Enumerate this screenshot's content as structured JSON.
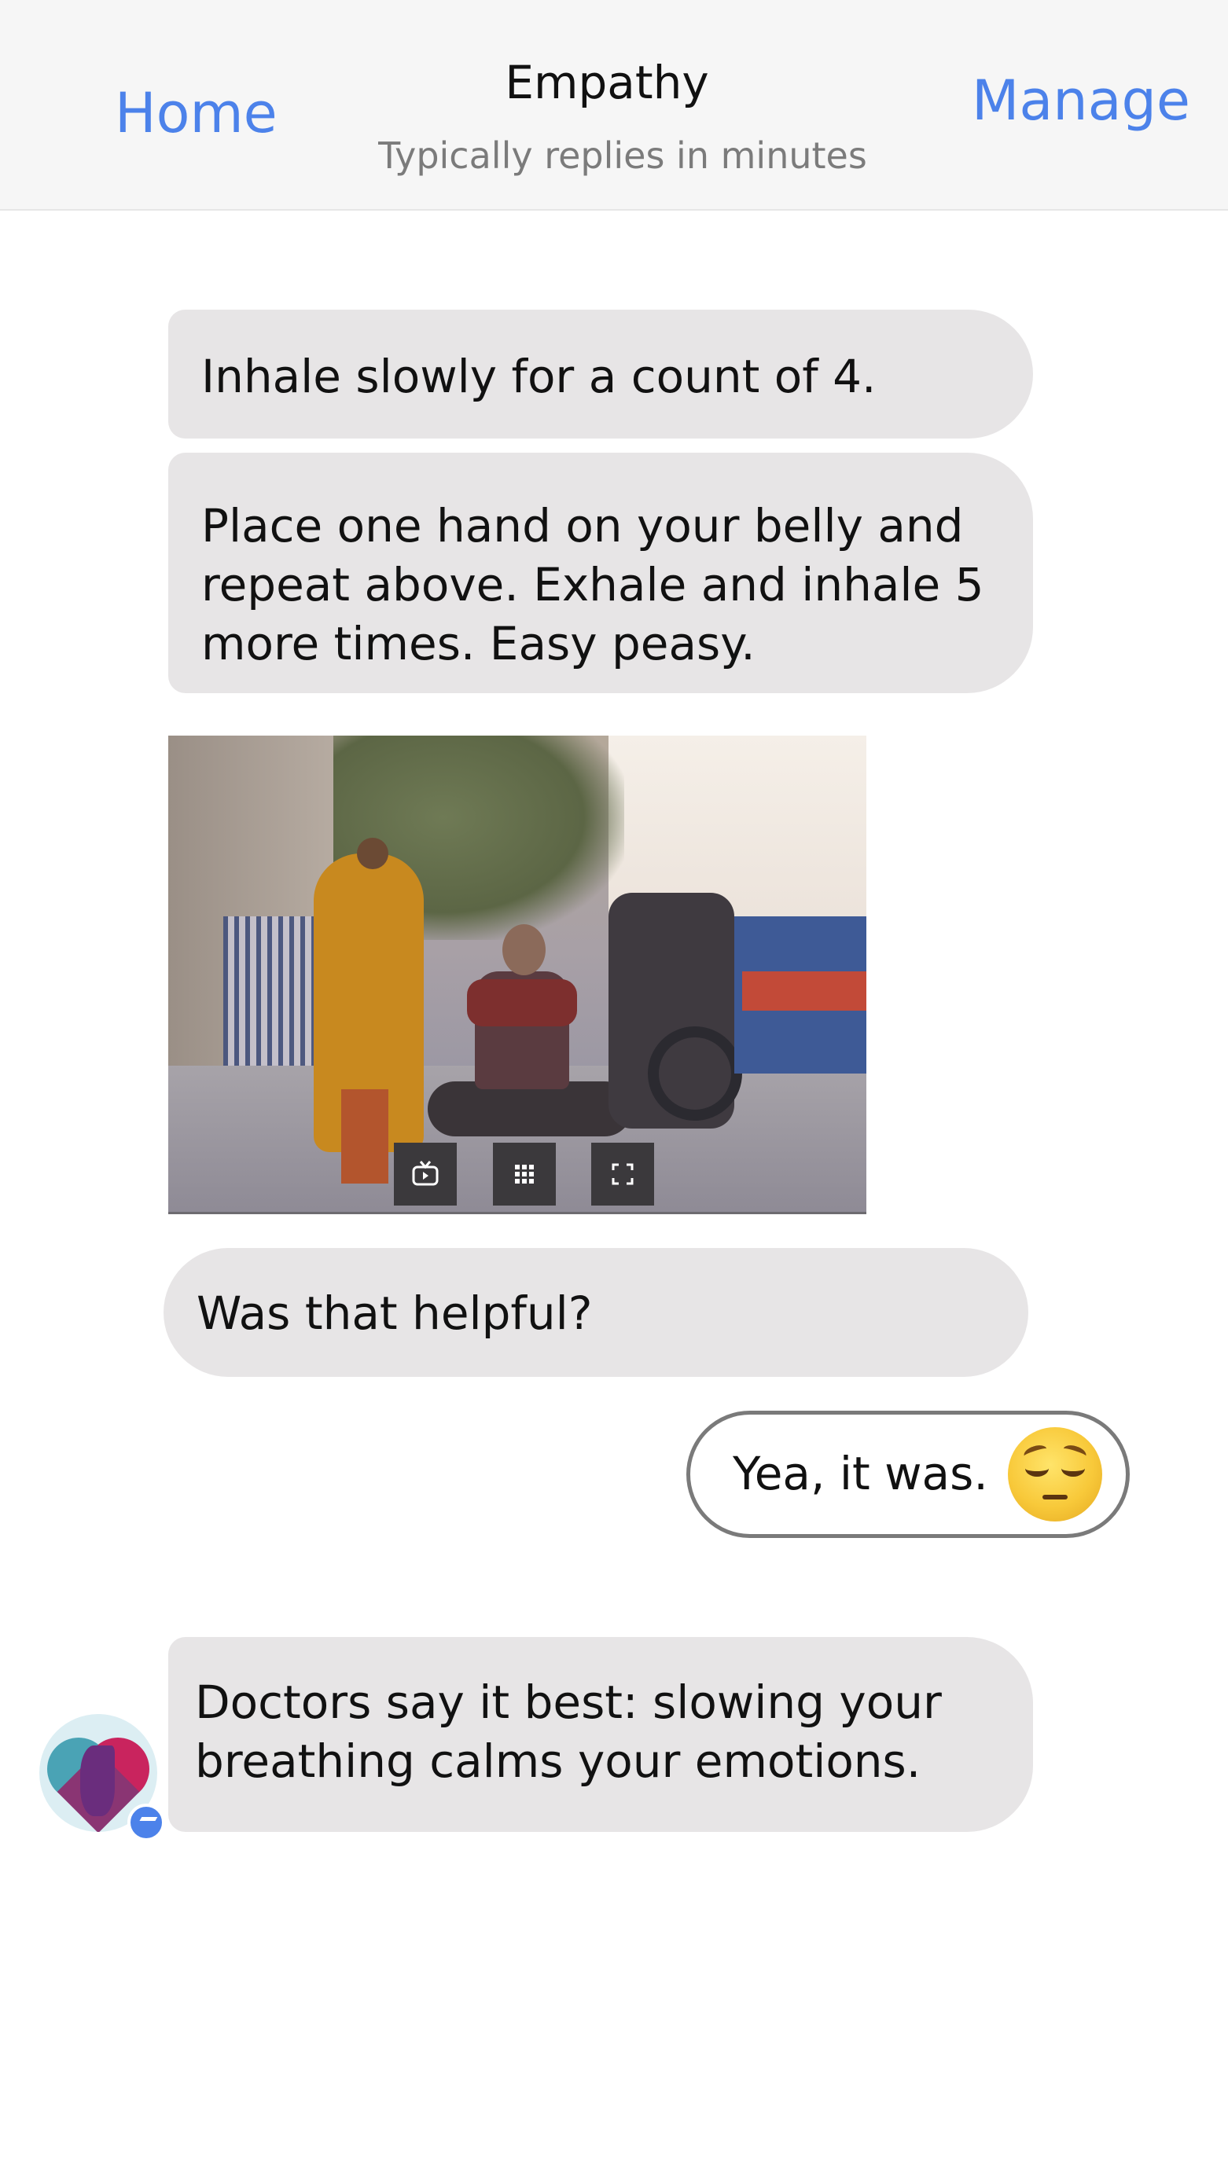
{
  "header": {
    "back_label": "Home",
    "title": "Empathy",
    "subtitle": "Typically replies in minutes",
    "manage_label": "Manage"
  },
  "messages": [
    {
      "from": "bot",
      "text": "Inhale slowly for a count of 4."
    },
    {
      "from": "bot",
      "text": "Place one hand on your belly and repeat above. Exhale and inhale 5 more times. Easy peasy."
    },
    {
      "from": "bot",
      "type": "image",
      "controls": [
        "tv-icon",
        "grid-icon",
        "fullscreen-icon"
      ]
    },
    {
      "from": "bot",
      "text": "Was that helpful?"
    },
    {
      "from": "user",
      "text": "Yea, it was.",
      "emoji": "relieved-face"
    },
    {
      "from": "bot",
      "text": "Doctors say it best: slowing your breathing calms your emotions."
    }
  ],
  "colors": {
    "accent": "#4c82ea",
    "bubble": "#e7e5e6",
    "header_bg": "#f6f6f6"
  }
}
